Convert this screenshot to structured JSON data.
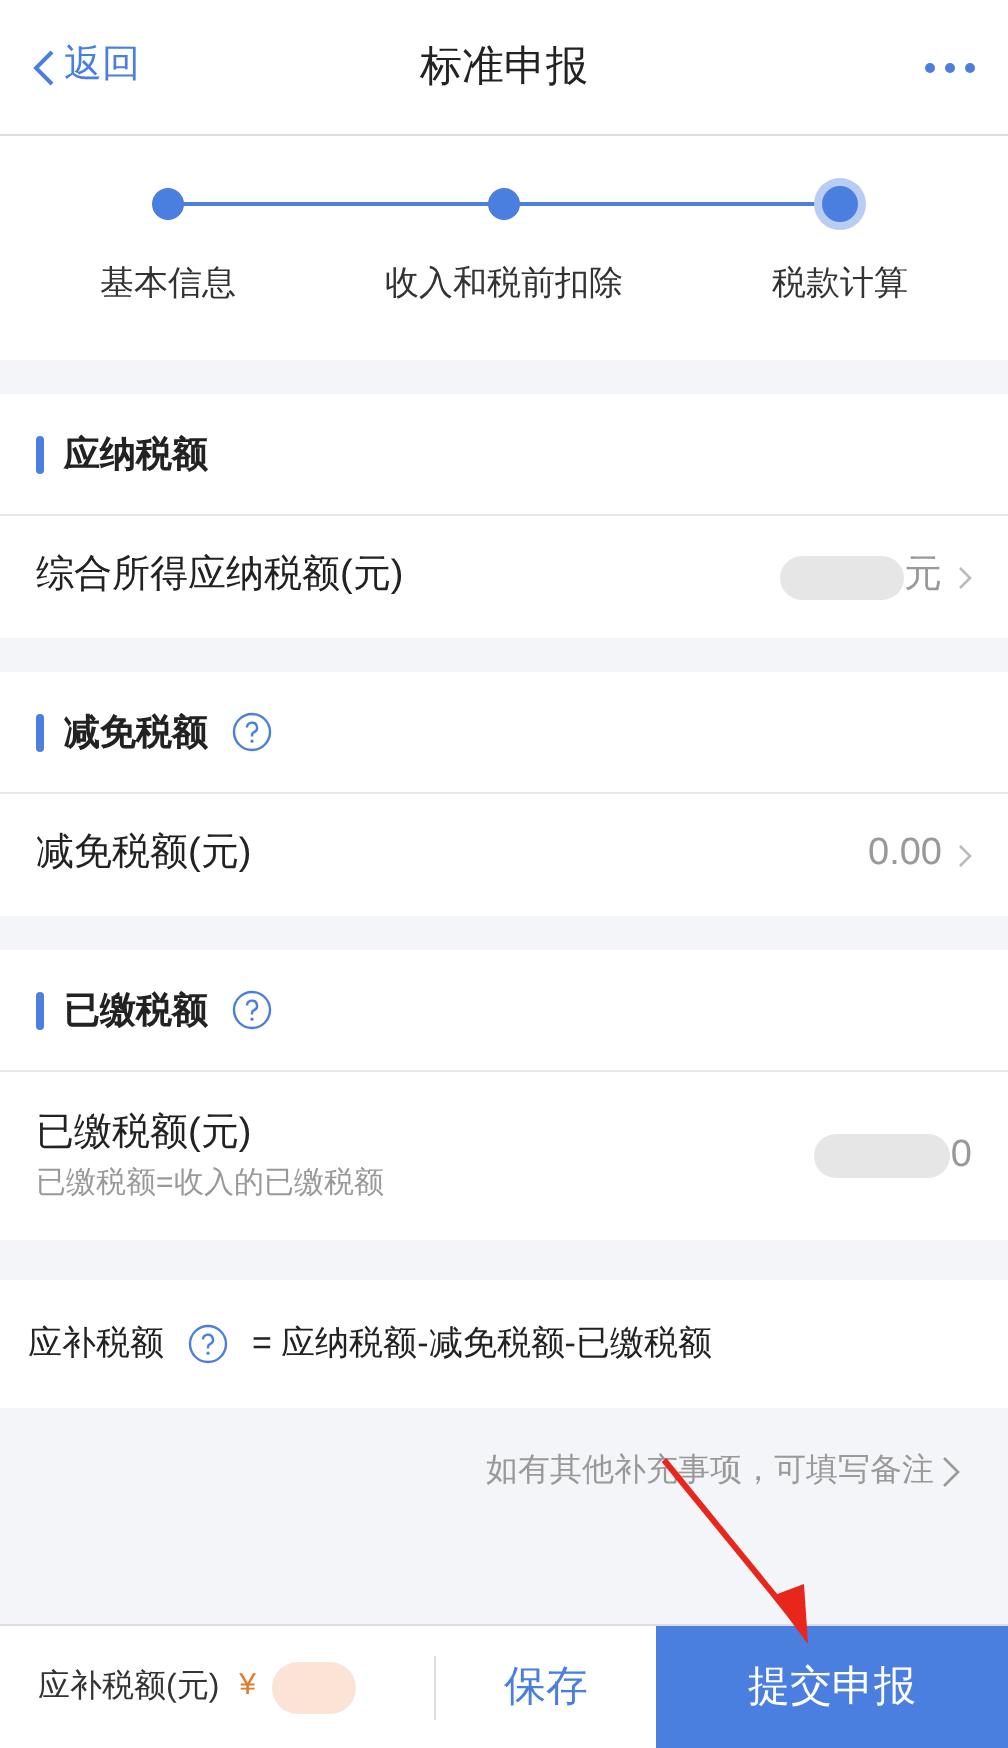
{
  "nav": {
    "back": "返回",
    "title": "标准申报"
  },
  "steps": [
    {
      "label": "基本信息",
      "selected": false
    },
    {
      "label": "收入和税前扣除",
      "selected": false
    },
    {
      "label": "税款计算",
      "selected": true
    }
  ],
  "sections": [
    {
      "title": "应纳税额",
      "help": false,
      "rows": [
        {
          "label": "综合所得应纳税额(元)",
          "value": "元",
          "masked": true,
          "chevron": true
        }
      ]
    },
    {
      "title": "减免税额",
      "help": true,
      "rows": [
        {
          "label": "减免税额(元)",
          "value": "0.00",
          "masked": false,
          "chevron": true
        }
      ]
    },
    {
      "title": "已缴税额",
      "help": true,
      "rows": [
        {
          "label": "已缴税额(元)",
          "note": "已缴税额=收入的已缴税额",
          "value": "0",
          "masked": true,
          "chevron": false
        }
      ]
    }
  ],
  "formula": {
    "label": "应补税额",
    "help": true,
    "expression": "= 应纳税额-减免税额-已缴税额"
  },
  "remark_link": "如有其他补充事项，可填写备注",
  "footer": {
    "label": "应补税额(元)",
    "currency": "¥",
    "masked": true,
    "save": "保存",
    "submit": "提交申报"
  }
}
